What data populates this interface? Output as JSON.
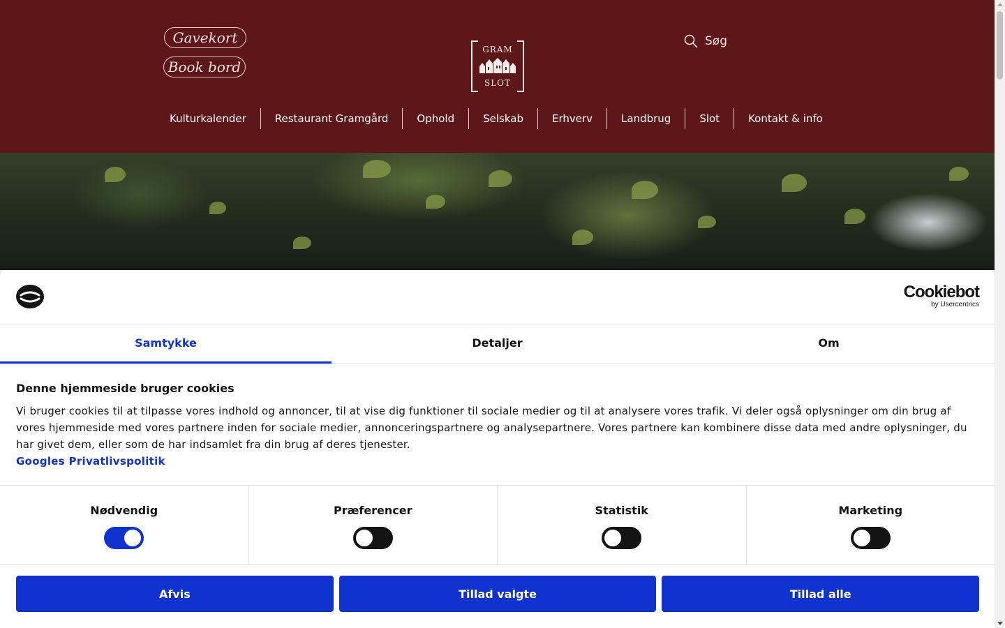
{
  "colors": {
    "header_bg": "#5e1719",
    "accent_blue": "#1032cf",
    "toggle_off": "#141414"
  },
  "header": {
    "gift_card_label": "Gavekort",
    "book_table_label": "Book bord",
    "logo_top": "GRAM",
    "logo_bottom": "SLOT",
    "search_label": "Søg",
    "search_icon": "search-icon"
  },
  "nav": [
    {
      "label": "Kulturkalender"
    },
    {
      "label": "Restaurant Gramgård"
    },
    {
      "label": "Ophold"
    },
    {
      "label": "Selskab"
    },
    {
      "label": "Erhverv"
    },
    {
      "label": "Landbrug"
    },
    {
      "label": "Slot"
    },
    {
      "label": "Kontakt & info"
    }
  ],
  "cookie": {
    "brand": "Cookiebot",
    "brand_sub": "by Usercentrics",
    "tabs": [
      {
        "label": "Samtykke",
        "active": true
      },
      {
        "label": "Detaljer",
        "active": false
      },
      {
        "label": "Om",
        "active": false
      }
    ],
    "title": "Denne hjemmeside bruger cookies",
    "text": "Vi bruger cookies til at tilpasse vores indhold og annoncer, til at vise dig funktioner til sociale medier og til at analysere vores trafik. Vi deler også oplysninger om din brug af vores hjemmeside med vores partnere inden for sociale medier, annonceringspartnere og analysepartnere. Vores partnere kan kombinere disse data med andre oplysninger, du har givet dem, eller som de har indsamlet fra din brug af deres tjenester.",
    "link": "Googles Privatlivspolitik",
    "categories": [
      {
        "label": "Nødvendig",
        "enabled": true
      },
      {
        "label": "Præferencer",
        "enabled": false
      },
      {
        "label": "Statistik",
        "enabled": false
      },
      {
        "label": "Marketing",
        "enabled": false
      }
    ],
    "buttons": {
      "reject": "Afvis",
      "allow_selected": "Tillad valgte",
      "allow_all": "Tillad alle"
    }
  }
}
